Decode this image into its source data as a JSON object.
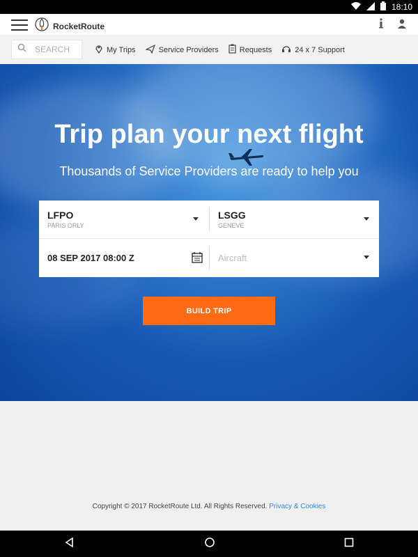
{
  "status": {
    "time": "18:10"
  },
  "app": {
    "name": "RocketRoute"
  },
  "search": {
    "placeholder": "SEARCH"
  },
  "nav": {
    "items": [
      {
        "label": "My Trips",
        "icon": "map-pin-icon"
      },
      {
        "label": "Service Providers",
        "icon": "plane-icon"
      },
      {
        "label": "Requests",
        "icon": "clipboard-icon"
      },
      {
        "label": "24 x 7 Support",
        "icon": "headset-icon"
      }
    ]
  },
  "hero": {
    "title": "Trip plan your next flight",
    "subtitle": "Thousands of Service Providers are ready to help you"
  },
  "form": {
    "from": {
      "code": "LFPO",
      "name": "PARIS ORLY"
    },
    "to": {
      "code": "LSGG",
      "name": "GENEVE"
    },
    "date": {
      "value": "08 SEP 2017 08:00 Z"
    },
    "aircraft": {
      "placeholder": "Aircraft"
    }
  },
  "cta": {
    "label": "BUILD TRIP"
  },
  "footer": {
    "copyright": "Copyright © 2017 RocketRoute Ltd. All Rights Reserved.",
    "link": "Privacy & Cookies"
  },
  "colors": {
    "accent": "#ff6a13",
    "link": "#2d8be2",
    "hero": "#1f66c0"
  }
}
